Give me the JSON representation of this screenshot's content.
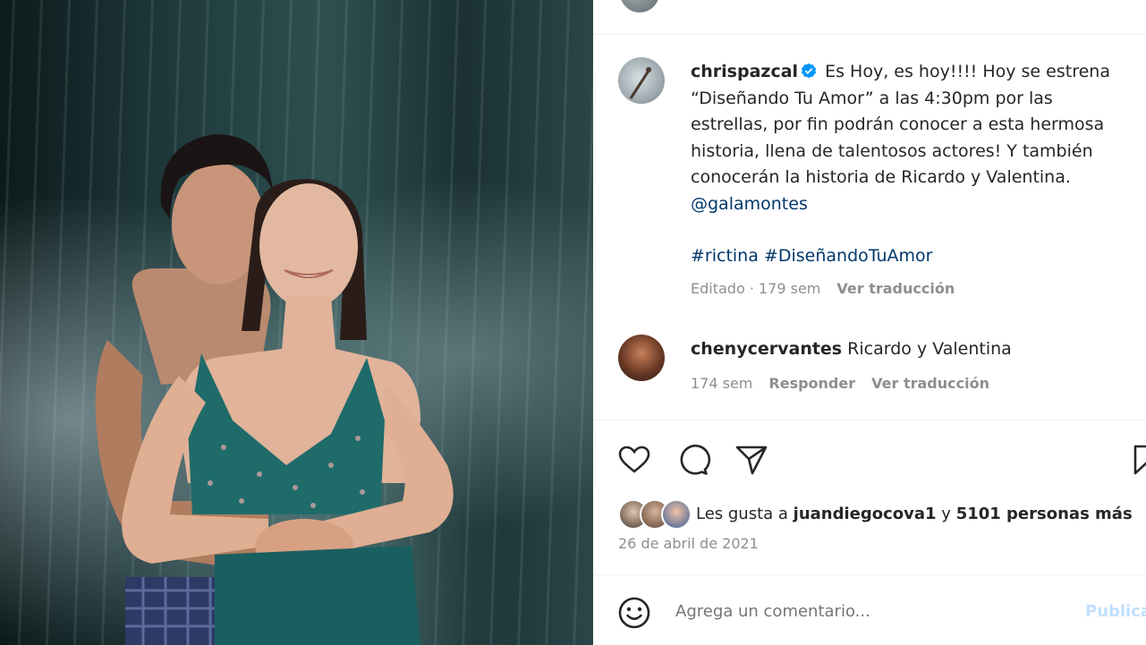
{
  "post": {
    "author": "chrispazcal",
    "caption_lines": [
      "Es Hoy, es hoy!!!! Hoy se estrena",
      "“Diseñando Tu Amor” a las 4:30pm por las",
      "estrellas, por fin podrán conocer a esta hermosa",
      "historia, llena de talentosos actores! Y también",
      "conocerán la historia de Ricardo y Valentina."
    ],
    "mention": "@galamontes",
    "hashtags": [
      "#rictina",
      "#DiseñandoTuAmor"
    ],
    "meta_time": "Editado · 179 sem",
    "see_translation": "Ver traducción",
    "verified_color": "#0095f6"
  },
  "comment": {
    "username": "chenycervantes",
    "text": "Ricardo y Valentina",
    "time": "174 sem",
    "reply": "Responder",
    "see_translation": "Ver traducción"
  },
  "actions": {
    "icons": [
      "heart-icon",
      "comment-icon",
      "share-icon",
      "bookmark-icon"
    ]
  },
  "likes": {
    "prefix": "Les gusta a ",
    "user": "juandiegocova1",
    "connector": " y ",
    "others": "5101 personas más"
  },
  "date": "26 de abril de 2021",
  "comment_box": {
    "placeholder": "Agrega un comentario...",
    "publish_label": "Publicar"
  }
}
